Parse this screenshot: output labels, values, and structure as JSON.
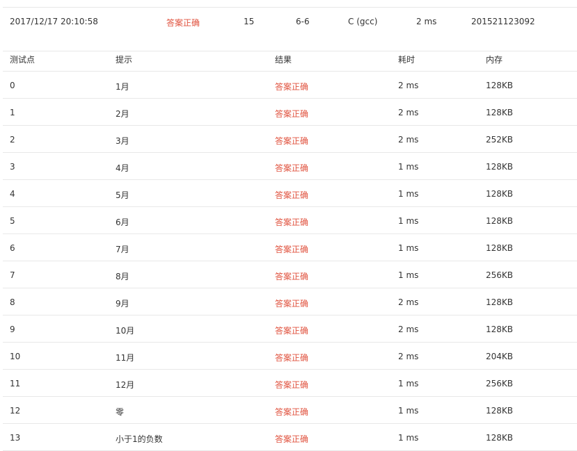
{
  "summary": {
    "submit_time": "2017/12/17 20:10:58",
    "result": "答案正确",
    "score": "15",
    "problem": "6-6",
    "compiler": "C (gcc)",
    "time": "2 ms",
    "user": "201521123092"
  },
  "table": {
    "headers": [
      "测试点",
      "提示",
      "结果",
      "耗时",
      "内存"
    ],
    "rows": [
      {
        "id": "0",
        "hint": "1月",
        "result": "答案正确",
        "time": "2 ms",
        "memory": "128KB"
      },
      {
        "id": "1",
        "hint": "2月",
        "result": "答案正确",
        "time": "2 ms",
        "memory": "128KB"
      },
      {
        "id": "2",
        "hint": "3月",
        "result": "答案正确",
        "time": "2 ms",
        "memory": "252KB"
      },
      {
        "id": "3",
        "hint": "4月",
        "result": "答案正确",
        "time": "1 ms",
        "memory": "128KB"
      },
      {
        "id": "4",
        "hint": "5月",
        "result": "答案正确",
        "time": "1 ms",
        "memory": "128KB"
      },
      {
        "id": "5",
        "hint": "6月",
        "result": "答案正确",
        "time": "1 ms",
        "memory": "128KB"
      },
      {
        "id": "6",
        "hint": "7月",
        "result": "答案正确",
        "time": "1 ms",
        "memory": "128KB"
      },
      {
        "id": "7",
        "hint": "8月",
        "result": "答案正确",
        "time": "1 ms",
        "memory": "256KB"
      },
      {
        "id": "8",
        "hint": "9月",
        "result": "答案正确",
        "time": "2 ms",
        "memory": "128KB"
      },
      {
        "id": "9",
        "hint": "10月",
        "result": "答案正确",
        "time": "2 ms",
        "memory": "128KB"
      },
      {
        "id": "10",
        "hint": "11月",
        "result": "答案正确",
        "time": "2 ms",
        "memory": "204KB"
      },
      {
        "id": "11",
        "hint": "12月",
        "result": "答案正确",
        "time": "1 ms",
        "memory": "256KB"
      },
      {
        "id": "12",
        "hint": "零",
        "result": "答案正确",
        "time": "1 ms",
        "memory": "128KB"
      },
      {
        "id": "13",
        "hint": "小于1的负数",
        "result": "答案正确",
        "time": "1 ms",
        "memory": "128KB"
      }
    ]
  },
  "colors": {
    "accepted": "#e0523e",
    "text": "#333333",
    "divider": "#e8e8e8"
  }
}
